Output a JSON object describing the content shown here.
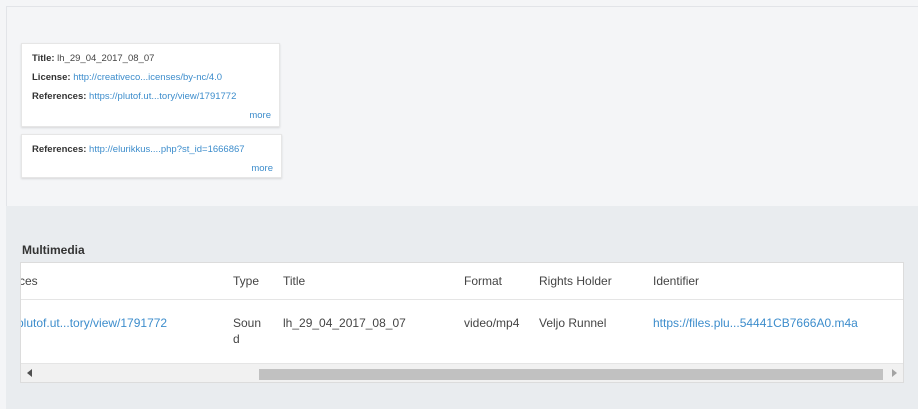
{
  "cards": [
    {
      "title_label": "Title:",
      "title_value": "lh_29_04_2017_08_07",
      "license_label": "License:",
      "license_value": "http://creativeco...icenses/by-nc/4.0",
      "references_label": "References:",
      "references_value": "https://plutof.ut...tory/view/1791772",
      "more": "more"
    },
    {
      "references_label": "References:",
      "references_value": "http://elurikkus....php?st_id=1666867",
      "more": "more"
    }
  ],
  "multimedia": {
    "section_title": "Multimedia",
    "columns": [
      "ces",
      "Type",
      "Title",
      "Format",
      "Rights Holder",
      "Identifier"
    ],
    "rows": [
      {
        "references": "plutof.ut...tory/view/1791772",
        "type": "Sound",
        "title": "lh_29_04_2017_08_07",
        "format": "video/mp4",
        "rights_holder": "Veljo Runnel",
        "identifier": "https://files.plu...54441CB7666A0.m4a"
      }
    ]
  },
  "colors": {
    "link": "#3d8dcc",
    "panel_bg": "#e9ecef",
    "page_bg": "#f4f5f7"
  }
}
